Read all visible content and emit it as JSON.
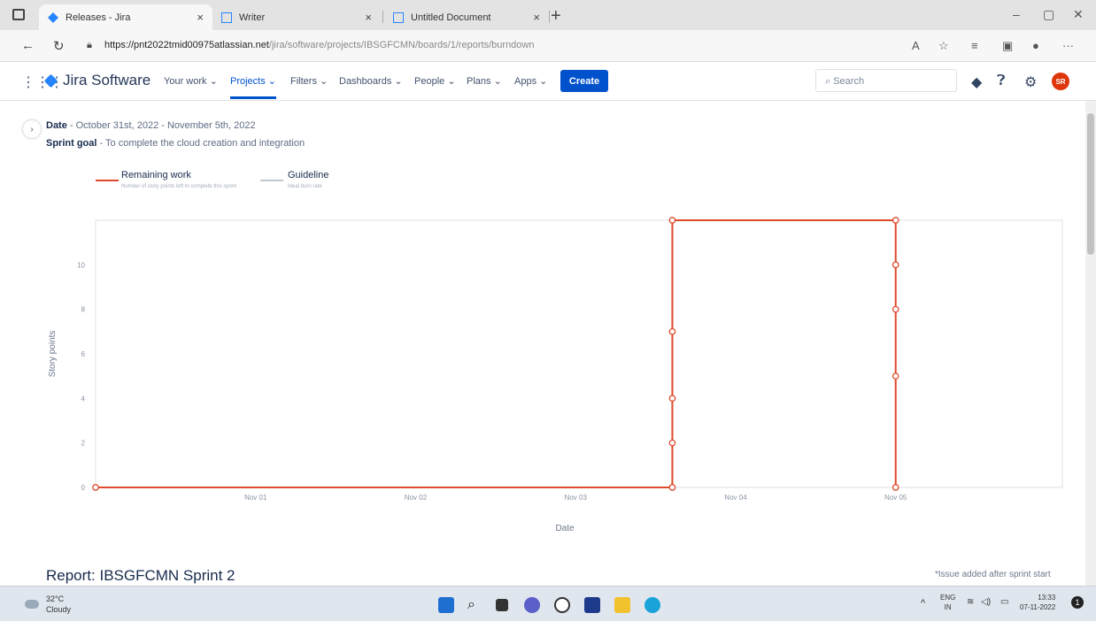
{
  "browser": {
    "tabs": [
      {
        "title": "Releases - Jira",
        "active": true
      },
      {
        "title": "Writer",
        "active": false
      },
      {
        "title": "Untitled Document",
        "active": false
      }
    ],
    "url_host": "https://pnt2022tmid00975atlassian.net",
    "url_path": "/jira/software/projects/IBSGFCMN/boards/1/reports/burndown"
  },
  "nav": {
    "product": "Jira Software",
    "items": [
      "Your work",
      "Projects",
      "Filters",
      "Dashboards",
      "People",
      "Plans",
      "Apps"
    ],
    "create": "Create",
    "search_placeholder": "Search",
    "avatar_initials": "SR"
  },
  "report": {
    "date_label": "Date",
    "date_value": "October 31st, 2022 - November 5th, 2022",
    "goal_label": "Sprint goal",
    "goal_value": "To complete the cloud creation and integration",
    "legend": [
      {
        "title": "Remaining work",
        "sub": "Number of story points left to complete this sprint",
        "color": "#de4a2b"
      },
      {
        "title": "Guideline",
        "sub": "Ideal burn rate",
        "color": "#c1c7d0"
      }
    ],
    "title": "Report: IBSGFCMN Sprint 2",
    "footnote": "*Issue added after sprint start"
  },
  "chart_data": {
    "type": "line",
    "xlabel": "Date",
    "ylabel": "Story points",
    "xticks": [
      "Nov 01",
      "Nov 02",
      "Nov 03",
      "Nov 04",
      "Nov 05"
    ],
    "yticks": [
      0,
      2,
      4,
      6,
      8,
      10
    ],
    "ylim": [
      0,
      12
    ],
    "grid": false,
    "series": [
      {
        "name": "Remaining work",
        "color": "#de4a2b",
        "points": [
          {
            "x": "2022-10-31 00:00",
            "y": 0
          },
          {
            "x": "2022-11-03 14:30",
            "y": 0
          },
          {
            "x": "2022-11-03 14:30",
            "y": 2
          },
          {
            "x": "2022-11-03 14:30",
            "y": 4
          },
          {
            "x": "2022-11-03 14:30",
            "y": 7
          },
          {
            "x": "2022-11-03 14:30",
            "y": 12
          },
          {
            "x": "2022-11-05 00:00",
            "y": 12
          },
          {
            "x": "2022-11-05 00:00",
            "y": 10
          },
          {
            "x": "2022-11-05 00:00",
            "y": 8
          },
          {
            "x": "2022-11-05 00:00",
            "y": 5
          },
          {
            "x": "2022-11-05 00:00",
            "y": 0
          }
        ]
      }
    ]
  },
  "taskbar": {
    "temp": "32°C",
    "condition": "Cloudy",
    "lang1": "ENG",
    "lang2": "IN",
    "time": "13:33",
    "date": "07-11-2022"
  }
}
